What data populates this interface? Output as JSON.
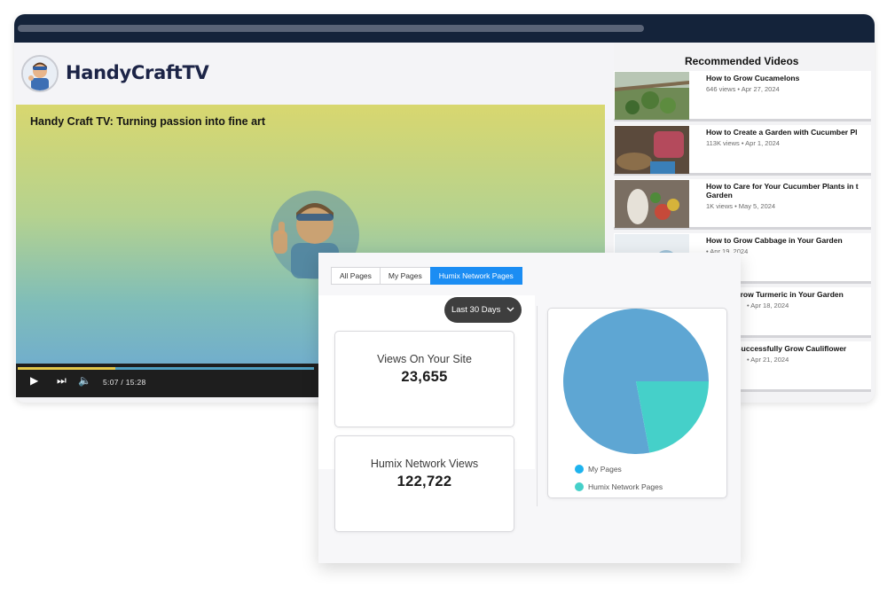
{
  "site": {
    "brand": "HandyCraftTV"
  },
  "player": {
    "title": "Handy Craft TV: Turning passion into fine art",
    "current_time": "5:07",
    "separator": "/",
    "duration": "15:28",
    "progress": 0.33
  },
  "recommended": {
    "heading": "Recommended Videos",
    "items": [
      {
        "title": "How to Grow Cucamelons",
        "meta": "646 views • Apr 27, 2024"
      },
      {
        "title": "How to Create a Garden with Cucumber Pl",
        "meta": "113K views • Apr 1, 2024"
      },
      {
        "title": "How to Care for Your Cucumber Plants in t Garden",
        "meta": "1K views • May 5, 2024"
      },
      {
        "title": "How to Grow Cabbage in Your Garden",
        "meta": "• Apr 19, 2024"
      },
      {
        "title": "Grow Turmeric in Your Garden",
        "meta": "• Apr 18, 2024"
      },
      {
        "title": "Successfully Grow Cauliflower",
        "meta": "• Apr 21, 2024"
      }
    ]
  },
  "analytics": {
    "tabs": [
      {
        "label": "All Pages",
        "active": false
      },
      {
        "label": "My Pages",
        "active": false
      },
      {
        "label": "Humix Network Pages",
        "active": true
      }
    ],
    "range_label": "Last 30 Days",
    "site_views": {
      "label": "Views On Your Site",
      "value": "23,655"
    },
    "network_views": {
      "label": "Humix Network Views",
      "value": "122,722"
    }
  },
  "chart_data": {
    "type": "pie",
    "slices": [
      {
        "label": "My Pages",
        "value": 0.78,
        "color": "#5ea6d3"
      },
      {
        "label": "Humix Network Pages",
        "value": 0.22,
        "color": "#45d0c9"
      }
    ],
    "legend": [
      {
        "label": "My Pages",
        "color": "#1eb3ee"
      },
      {
        "label": "Humix Network Pages",
        "color": "#45d0c9"
      }
    ],
    "legend_position": "bottom-left"
  }
}
